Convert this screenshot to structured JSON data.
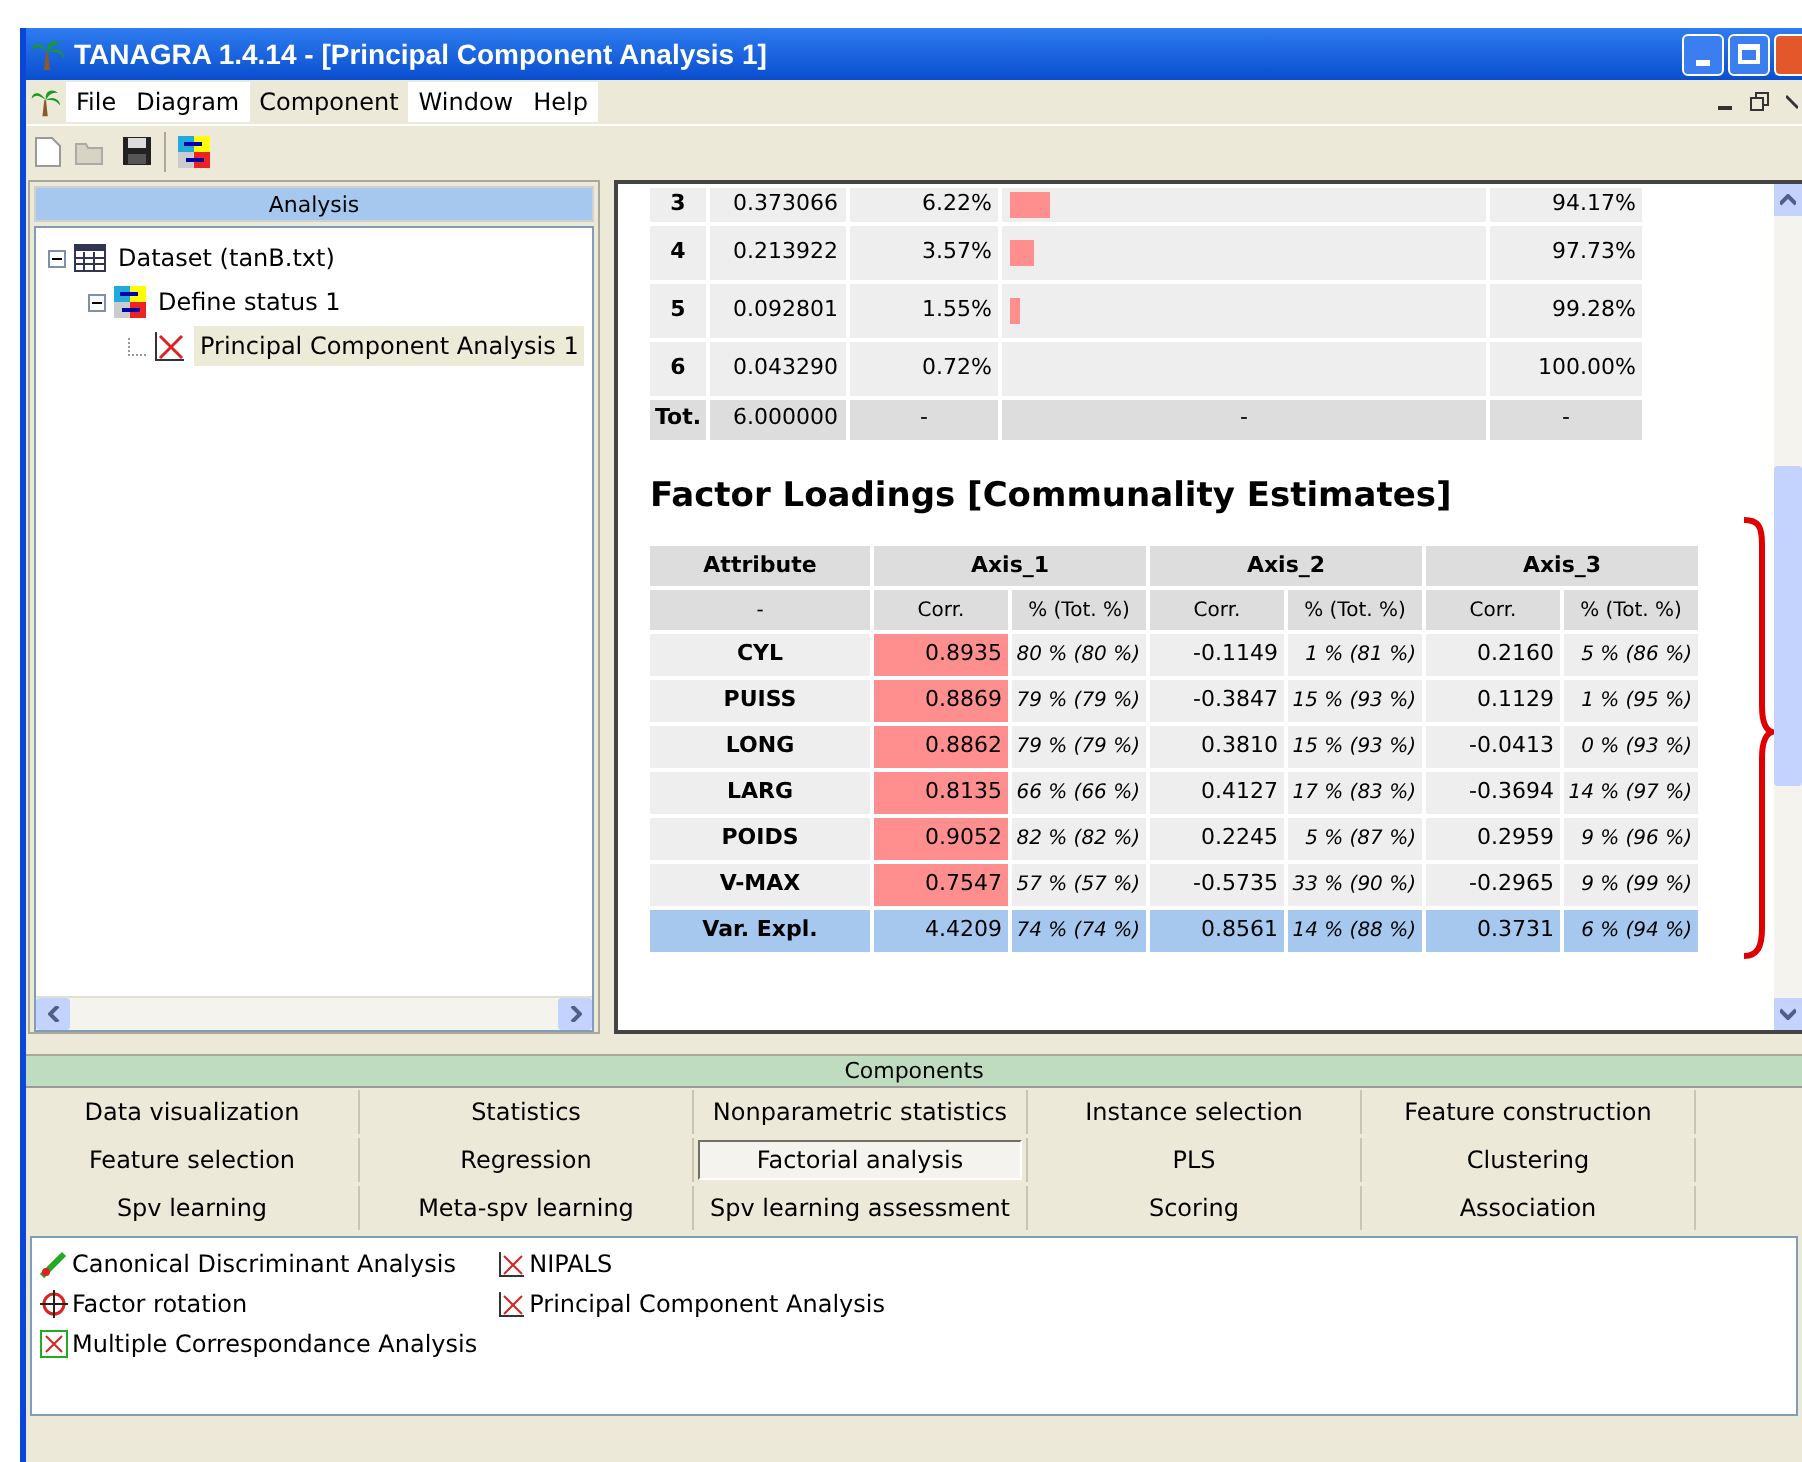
{
  "window": {
    "title": "TANAGRA 1.4.14 - [Principal Component Analysis 1]"
  },
  "menu": [
    {
      "label": "File",
      "selected": false
    },
    {
      "label": "Diagram",
      "selected": false
    },
    {
      "label": "Component",
      "selected": true
    },
    {
      "label": "Window",
      "selected": false
    },
    {
      "label": "Help",
      "selected": false
    }
  ],
  "analysis_panel": {
    "title": "Analysis",
    "tree": [
      {
        "label": "Dataset (tanB.txt)",
        "expanded": true,
        "selected": false,
        "children": [
          {
            "label": "Define status 1",
            "expanded": true,
            "selected": false,
            "children": [
              {
                "label": "Principal Component Analysis 1",
                "selected": true
              }
            ]
          }
        ]
      }
    ]
  },
  "eigen_table": {
    "rows": [
      {
        "index": "3",
        "value": "0.373066",
        "percent": "6.22%",
        "level": 0.084,
        "cumulative": "94.17%"
      },
      {
        "index": "4",
        "value": "0.213922",
        "percent": "3.57%",
        "level": 0.048,
        "cumulative": "97.73%"
      },
      {
        "index": "5",
        "value": "0.092801",
        "percent": "1.55%",
        "level": 0.021,
        "cumulative": "99.28%"
      },
      {
        "index": "6",
        "value": "0.043290",
        "percent": "0.72%",
        "level": 0,
        "cumulative": "100.00%"
      }
    ],
    "total": {
      "label": "Tot.",
      "value": "6.000000",
      "percent": "-",
      "bar": "-",
      "cumulative": "-"
    }
  },
  "loadings": {
    "title": "Factor Loadings [Communality Estimates]",
    "header": [
      "Attribute",
      "Axis_1",
      "Axis_2",
      "Axis_3"
    ],
    "subheader": [
      "-",
      "Corr.",
      "% (Tot. %)",
      "Corr.",
      "% (Tot. %)",
      "Corr.",
      "% (Tot. %)"
    ],
    "rows": [
      {
        "kind": "data",
        "attribute": "CYL",
        "cells": [
          {
            "corr": "0.8935",
            "pct": "80 % (80 %)",
            "highlighted": true
          },
          {
            "corr": "-0.1149",
            "pct": "1 % (81 %)",
            "highlighted": false
          },
          {
            "corr": "0.2160",
            "pct": "5 % (86 %)",
            "highlighted": false
          }
        ]
      },
      {
        "kind": "data",
        "attribute": "PUISS",
        "cells": [
          {
            "corr": "0.8869",
            "pct": "79 % (79 %)",
            "highlighted": true
          },
          {
            "corr": "-0.3847",
            "pct": "15 % (93 %)",
            "highlighted": false
          },
          {
            "corr": "0.1129",
            "pct": "1 % (95 %)",
            "highlighted": false
          }
        ]
      },
      {
        "kind": "data",
        "attribute": "LONG",
        "cells": [
          {
            "corr": "0.8862",
            "pct": "79 % (79 %)",
            "highlighted": true
          },
          {
            "corr": "0.3810",
            "pct": "15 % (93 %)",
            "highlighted": false
          },
          {
            "corr": "-0.0413",
            "pct": "0 % (93 %)",
            "highlighted": false
          }
        ]
      },
      {
        "kind": "data",
        "attribute": "LARG",
        "cells": [
          {
            "corr": "0.8135",
            "pct": "66 % (66 %)",
            "highlighted": true
          },
          {
            "corr": "0.4127",
            "pct": "17 % (83 %)",
            "highlighted": false
          },
          {
            "corr": "-0.3694",
            "pct": "14 % (97 %)",
            "highlighted": false
          }
        ]
      },
      {
        "kind": "data",
        "attribute": "POIDS",
        "cells": [
          {
            "corr": "0.9052",
            "pct": "82 % (82 %)",
            "highlighted": true
          },
          {
            "corr": "0.2245",
            "pct": "5 % (87 %)",
            "highlighted": false
          },
          {
            "corr": "0.2959",
            "pct": "9 % (96 %)",
            "highlighted": false
          }
        ]
      },
      {
        "kind": "data",
        "attribute": "V-MAX",
        "cells": [
          {
            "corr": "0.7547",
            "pct": "57 % (57 %)",
            "highlighted": true
          },
          {
            "corr": "-0.5735",
            "pct": "33 % (90 %)",
            "highlighted": false
          },
          {
            "corr": "-0.2965",
            "pct": "9 % (99 %)",
            "highlighted": false
          }
        ]
      },
      {
        "kind": "total",
        "attribute": "Var. Expl.",
        "cells": [
          {
            "corr": "4.4209",
            "pct": "74 % (74 %)",
            "highlighted": false
          },
          {
            "corr": "0.8561",
            "pct": "14 % (88 %)",
            "highlighted": false
          },
          {
            "corr": "0.3731",
            "pct": "6 % (94 %)",
            "highlighted": false
          }
        ]
      }
    ]
  },
  "components": {
    "title": "Components",
    "tabs": [
      [
        {
          "label": "Data visualization",
          "selected": false
        },
        {
          "label": "Statistics",
          "selected": false
        },
        {
          "label": "Nonparametric statistics",
          "selected": false
        },
        {
          "label": "Instance selection",
          "selected": false
        },
        {
          "label": "Feature construction",
          "selected": false
        }
      ],
      [
        {
          "label": "Feature selection",
          "selected": false
        },
        {
          "label": "Regression",
          "selected": false
        },
        {
          "label": "Factorial analysis",
          "selected": true
        },
        {
          "label": "PLS",
          "selected": false
        },
        {
          "label": "Clustering",
          "selected": false
        }
      ],
      [
        {
          "label": "Spv learning",
          "selected": false
        },
        {
          "label": "Meta-spv learning",
          "selected": false
        },
        {
          "label": "Spv learning assessment",
          "selected": false
        },
        {
          "label": "Scoring",
          "selected": false
        },
        {
          "label": "Association",
          "selected": false
        }
      ]
    ],
    "items": [
      [
        "Canonical Discriminant Analysis",
        "Factor rotation",
        "Multiple Correspondance Analysis"
      ],
      [
        "NIPALS",
        "Principal Component Analysis"
      ]
    ]
  }
}
